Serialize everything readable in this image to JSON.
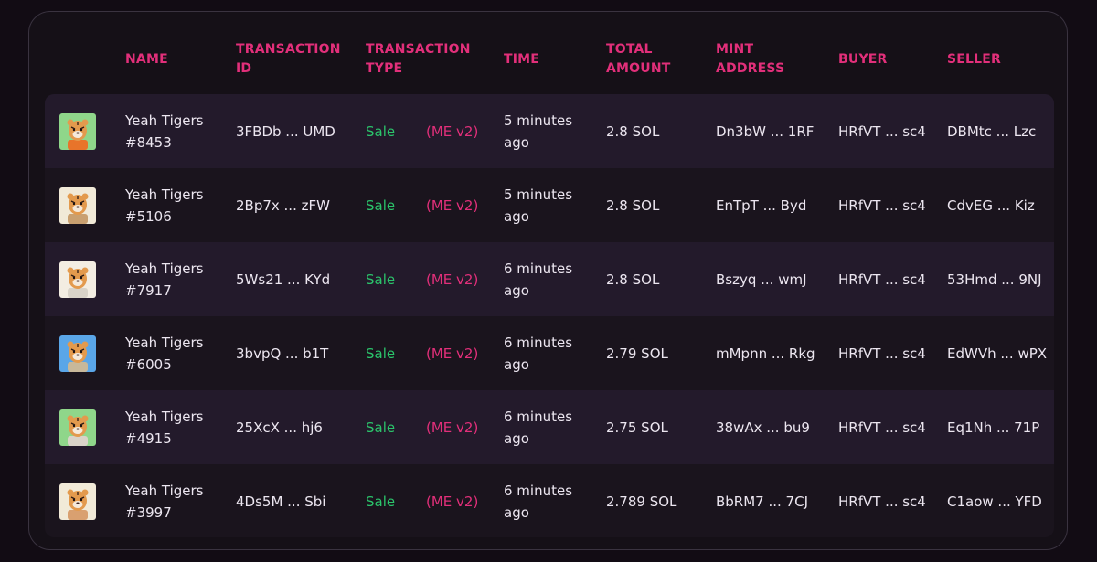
{
  "headers": {
    "name": "NAME",
    "transaction_id": "TRANSACTION ID",
    "transaction_type": "TRANSACTION TYPE",
    "time": "TIME",
    "total_amount": "TOTAL AMOUNT",
    "mint_address": "MINT ADDRESS",
    "buyer": "BUYER",
    "seller": "SELLER"
  },
  "rows": [
    {
      "name": "Yeah Tigers #8453",
      "tx_id": "3FBDb ... UMD",
      "type": "Sale",
      "market": "(ME v2)",
      "time": "5 minutes ago",
      "amount": "2.8 SOL",
      "mint": "Dn3bW ... 1RF",
      "buyer": "HRfVT ... sc4",
      "seller": "DBMtc ... Lzc",
      "avatar_bg": "#8fd68a",
      "avatar_body": "#e8742a",
      "avatar_icon": "tiger-avatar-icon"
    },
    {
      "name": "Yeah Tigers #5106",
      "tx_id": "2Bp7x ... zFW",
      "type": "Sale",
      "market": "(ME v2)",
      "time": "5 minutes ago",
      "amount": "2.8 SOL",
      "mint": "EnTpT ... Byd",
      "buyer": "HRfVT ... sc4",
      "seller": "CdvEG ... Kiz",
      "avatar_bg": "#f1ead8",
      "avatar_body": "#c9a070",
      "avatar_icon": "tiger-avatar-icon"
    },
    {
      "name": "Yeah Tigers #7917",
      "tx_id": "5Ws21 ... KYd",
      "type": "Sale",
      "market": "(ME v2)",
      "time": "6 minutes ago",
      "amount": "2.8 SOL",
      "mint": "Bszyq ... wmJ",
      "buyer": "HRfVT ... sc4",
      "seller": "53Hmd ... 9NJ",
      "avatar_bg": "#f3ede2",
      "avatar_body": "#d9d3c8",
      "avatar_icon": "tiger-avatar-icon"
    },
    {
      "name": "Yeah Tigers #6005",
      "tx_id": "3bvpQ ... b1T",
      "type": "Sale",
      "market": "(ME v2)",
      "time": "6 minutes ago",
      "amount": "2.79 SOL",
      "mint": "mMpnn ... Rkg",
      "buyer": "HRfVT ... sc4",
      "seller": "EdWVh ... wPX",
      "avatar_bg": "#5aa6e8",
      "avatar_body": "#c8b89a",
      "avatar_icon": "tiger-avatar-icon"
    },
    {
      "name": "Yeah Tigers #4915",
      "tx_id": "25XcX ... hj6",
      "type": "Sale",
      "market": "(ME v2)",
      "time": "6 minutes ago",
      "amount": "2.75 SOL",
      "mint": "38wAx ... bu9",
      "buyer": "HRfVT ... sc4",
      "seller": "Eq1Nh ... 71P",
      "avatar_bg": "#8fd68a",
      "avatar_body": "#d9d3c8",
      "avatar_icon": "tiger-avatar-icon"
    },
    {
      "name": "Yeah Tigers #3997",
      "tx_id": "4Ds5M ... Sbi",
      "type": "Sale",
      "market": "(ME v2)",
      "time": "6 minutes ago",
      "amount": "2.789 SOL",
      "mint": "BbRM7 ... 7CJ",
      "buyer": "HRfVT ... sc4",
      "seller": "C1aow ... YFD",
      "avatar_bg": "#f1ead8",
      "avatar_body": "#d9a070",
      "avatar_icon": "tiger-avatar-icon"
    }
  ]
}
